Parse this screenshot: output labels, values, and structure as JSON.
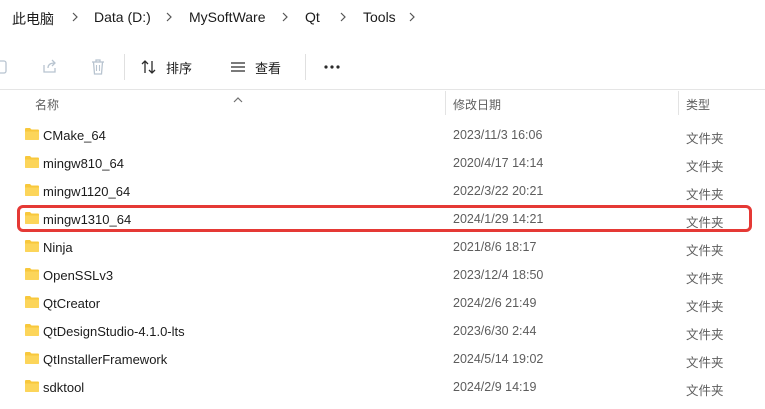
{
  "breadcrumb": [
    "此电脑",
    "Data (D:)",
    "MySoftWare",
    "Qt",
    "Tools"
  ],
  "toolbar": {
    "sort_label": "排序",
    "view_label": "查看",
    "more_label": "..."
  },
  "columns": {
    "name": "名称",
    "modified": "修改日期",
    "type": "类型"
  },
  "files": [
    {
      "name": "CMake_64",
      "modified": "2023/11/3 16:06",
      "type": "文件夹"
    },
    {
      "name": "mingw810_64",
      "modified": "2020/4/17 14:14",
      "type": "文件夹"
    },
    {
      "name": "mingw1120_64",
      "modified": "2022/3/22 20:21",
      "type": "文件夹"
    },
    {
      "name": "mingw1310_64",
      "modified": "2024/1/29 14:21",
      "type": "文件夹"
    },
    {
      "name": "Ninja",
      "modified": "2021/8/6 18:17",
      "type": "文件夹"
    },
    {
      "name": "OpenSSLv3",
      "modified": "2023/12/4 18:50",
      "type": "文件夹"
    },
    {
      "name": "QtCreator",
      "modified": "2024/2/6 21:49",
      "type": "文件夹"
    },
    {
      "name": "QtDesignStudio-4.1.0-lts",
      "modified": "2023/6/30 2:44",
      "type": "文件夹"
    },
    {
      "name": "QtInstallerFramework",
      "modified": "2024/5/14 19:02",
      "type": "文件夹"
    },
    {
      "name": "sdktool",
      "modified": "2024/2/9 14:19",
      "type": "文件夹"
    }
  ],
  "colors": {
    "folder": "#F8C83C",
    "highlight": "#E53935"
  }
}
